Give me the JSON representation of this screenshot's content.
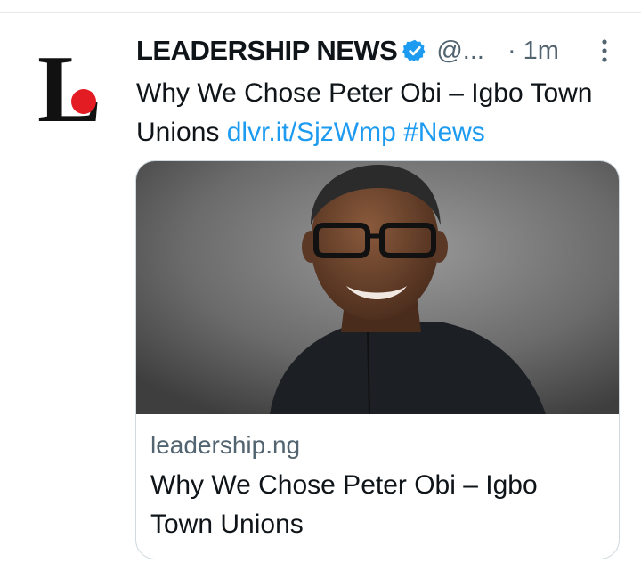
{
  "tweet": {
    "author_name": "LEADERSHIP NEWS",
    "handle": "@...",
    "dot": "·",
    "time": "1m",
    "text_plain": "Why We Chose Peter Obi – Igbo Town Unions",
    "link_text": "dlvr.it/SjzWmp",
    "hashtag": "#News"
  },
  "card": {
    "domain": "leadership.ng",
    "title": "Why We Chose Peter Obi – Igbo Town Unions"
  },
  "icons": {
    "avatar": "leadership-logo",
    "verified": "verified-badge-icon",
    "more": "more-options-icon"
  },
  "colors": {
    "link": "#1d9bf0",
    "verified": "#1d9bf0",
    "logo_dot": "#e31b23",
    "secondary_text": "#536471"
  }
}
